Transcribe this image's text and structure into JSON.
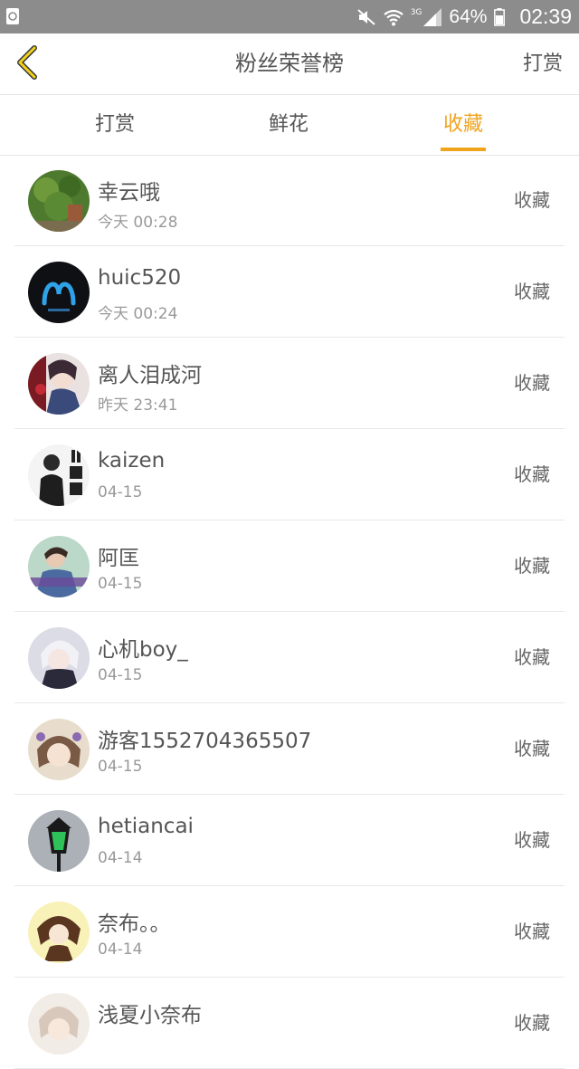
{
  "status_bar": {
    "battery_percent": "64%",
    "time": "02:39",
    "network_label": "3G"
  },
  "header": {
    "title": "粉丝荣誉榜",
    "action_label": "打赏"
  },
  "tabs": [
    {
      "label": "打赏",
      "active": false
    },
    {
      "label": "鲜花",
      "active": false
    },
    {
      "label": "收藏",
      "active": true
    }
  ],
  "colors": {
    "accent": "#f0a41d",
    "status_bar": "#8c8c8c"
  },
  "list": [
    {
      "name": "幸云哦",
      "time": "今天 00:28",
      "action": "收藏"
    },
    {
      "name": "huic520",
      "time": "今天 00:24",
      "action": "收藏"
    },
    {
      "name": "离人泪成河",
      "time": "昨天 23:41",
      "action": "收藏"
    },
    {
      "name": "kaizen",
      "time": "04-15",
      "action": "收藏"
    },
    {
      "name": "阿匡",
      "time": "04-15",
      "action": "收藏"
    },
    {
      "name": "心机boy_",
      "time": "04-15",
      "action": "收藏"
    },
    {
      "name": "游客1552704365507",
      "time": "04-15",
      "action": "收藏"
    },
    {
      "name": "hetiancai",
      "time": "04-14",
      "action": "收藏"
    },
    {
      "name": "奈布。。",
      "time": "04-14",
      "action": "收藏"
    },
    {
      "name": "浅夏小奈布",
      "time": "",
      "action": "收藏"
    }
  ]
}
